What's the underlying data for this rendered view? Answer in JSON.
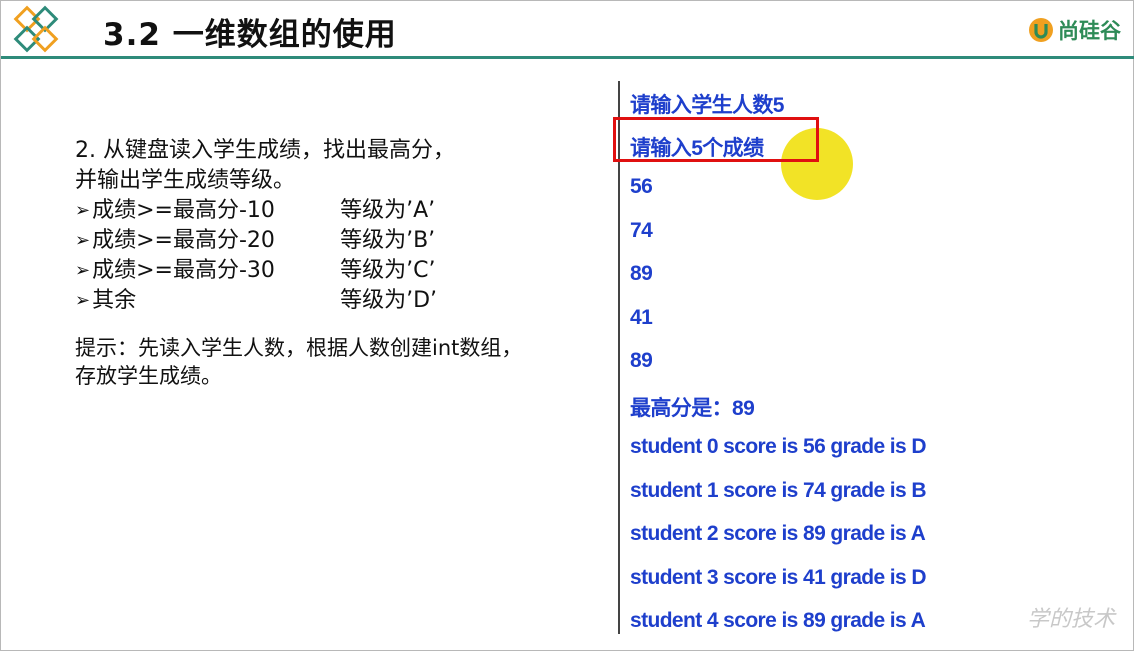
{
  "header": {
    "title": "3.2 一维数组的使用",
    "brand_name": "尚硅谷",
    "brand_color": "#2e8b57",
    "rule_color": "#2e8b7a"
  },
  "problem": {
    "line1": "2. 从键盘读入学生成绩，找出最高分，",
    "line2": "并输出学生成绩等级。",
    "rules": [
      {
        "marker": "➢",
        "condition": "成绩>=最高分-10",
        "grade": "等级为’A’"
      },
      {
        "marker": "➢",
        "condition": "成绩>=最高分-20",
        "grade": "等级为’B’"
      },
      {
        "marker": "➢",
        "condition": "成绩>=最高分-30",
        "grade": "等级为’C’"
      },
      {
        "marker": "➢",
        "condition": "其余",
        "grade": "等级为’D’"
      }
    ],
    "hint_line1": "提示：先读入学生人数，根据人数创建int数组，",
    "hint_line2": "存放学生成绩。"
  },
  "console": {
    "text_color": "#1e3fcc",
    "lines": [
      "请输入学生人数5",
      "请输入5个成绩",
      "56",
      "74",
      "89",
      "41",
      "89",
      "最高分是：89",
      "student 0 score is 56  grade is D",
      "student 1 score is 74  grade is B",
      "student 2 score is 89  grade is A",
      "student 3 score is 41  grade is D",
      "student 4 score is 89  grade is A"
    ]
  },
  "watermark": "学的技术"
}
